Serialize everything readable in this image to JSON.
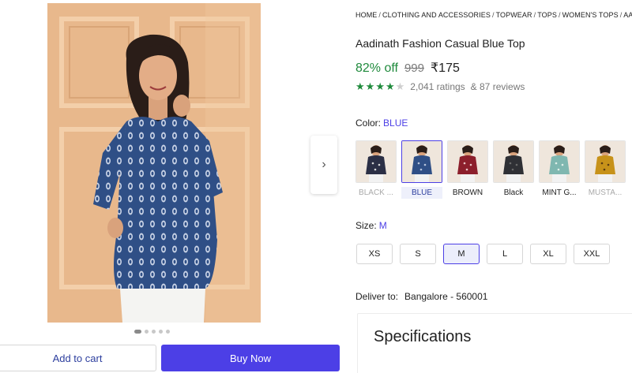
{
  "gallery": {
    "next_arrow": "›",
    "dots": [
      true,
      false,
      false,
      false,
      false
    ]
  },
  "actions": {
    "add_to_cart": "Add to cart",
    "buy_now": "Buy Now"
  },
  "breadcrumb": [
    "HOME",
    "CLOTHING AND ACCESSORIES",
    "TOPWEAR",
    "TOPS",
    "WOMEN'S TOPS",
    "AADINATH"
  ],
  "product": {
    "title": "Aadinath Fashion Casual Blue Top",
    "discount": "82% off",
    "mrp": "999",
    "price": "₹175",
    "rating_stars": 4,
    "ratings": "2,041 ratings",
    "reviews": "& 87 reviews"
  },
  "color": {
    "label": "Color:",
    "selected": "BLUE",
    "options": [
      {
        "name": "BLACK ...",
        "muted": true,
        "selected": false,
        "dress": "#2b2f45",
        "print": "#d8d8d8"
      },
      {
        "name": "BLUE",
        "muted": false,
        "selected": true,
        "dress": "#2f4f86",
        "print": "#b7c4db"
      },
      {
        "name": "BROWN",
        "muted": false,
        "selected": false,
        "dress": "#8c1f2c",
        "print": "#e7c7c7"
      },
      {
        "name": "Black",
        "muted": false,
        "selected": false,
        "dress": "#2f3035",
        "print": "#6a6a6a"
      },
      {
        "name": "MINT G...",
        "muted": false,
        "selected": false,
        "dress": "#7fb7b0",
        "print": "#e1efe9"
      },
      {
        "name": "MUSTA...",
        "muted": true,
        "selected": false,
        "dress": "#c7921a",
        "print": "#5a3b12"
      }
    ]
  },
  "size": {
    "label": "Size:",
    "selected": "M",
    "options": [
      "XS",
      "S",
      "M",
      "L",
      "XL",
      "XXL"
    ]
  },
  "delivery": {
    "label": "Deliver to:",
    "location": "Bangalore - 560001"
  },
  "specifications": {
    "title": "Specifications"
  }
}
